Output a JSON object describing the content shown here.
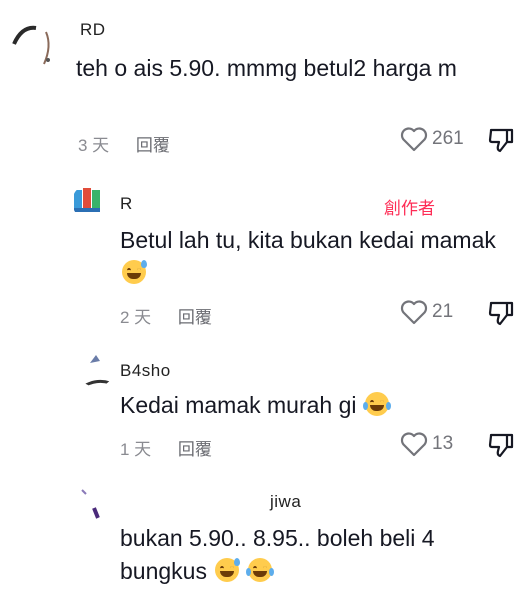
{
  "comments": [
    {
      "username": "RD",
      "text": "teh o ais 5.90. mmmg betul2 harga m",
      "time": "3 天",
      "reply": "回覆",
      "likes": "261"
    },
    {
      "username": "R",
      "creator_tag": "創作者",
      "text": "Betul lah tu, kita bukan kedai mamak",
      "time": "2 天",
      "reply": "回覆",
      "likes": "21"
    },
    {
      "username": "B4sho",
      "text": "Kedai mamak murah gi",
      "time": "1 天",
      "reply": "回覆",
      "likes": "13"
    },
    {
      "username": "jiwa",
      "text": "bukan 5.90.. 8.95.. boleh beli 4 bungkus",
      "time": "",
      "reply": "",
      "likes": ""
    }
  ],
  "colors": {
    "accent": "#fe2c55",
    "meta": "#8a8b91",
    "text": "#161823"
  },
  "icons": {
    "like": "heart-outline-icon",
    "dislike": "thumb-down-outline-icon",
    "laugh": "grinning-sweat-emoji",
    "tears": "tears-of-joy-emoji"
  }
}
